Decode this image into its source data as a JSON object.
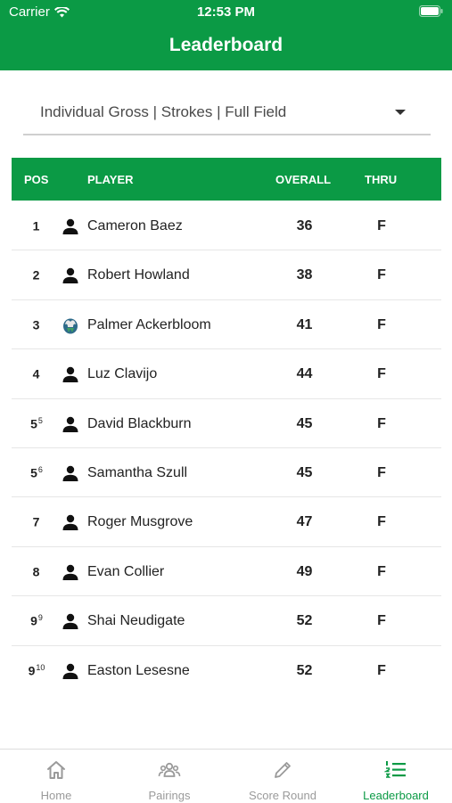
{
  "status_bar": {
    "carrier": "Carrier",
    "time": "12:53 PM"
  },
  "header": {
    "title": "Leaderboard"
  },
  "filter": {
    "selected": "Individual Gross | Strokes | Full Field"
  },
  "table": {
    "columns": {
      "pos": "POS",
      "player": "PLAYER",
      "overall": "OVERALL",
      "thru": "THRU"
    },
    "rows": [
      {
        "pos": "1",
        "tiebreak": "",
        "player": "Cameron Baez",
        "overall": "36",
        "thru": "F",
        "icon": "person-icon"
      },
      {
        "pos": "2",
        "tiebreak": "",
        "player": "Robert Howland",
        "overall": "38",
        "thru": "F",
        "icon": "person-icon"
      },
      {
        "pos": "3",
        "tiebreak": "",
        "player": "Palmer Ackerbloom",
        "overall": "41",
        "thru": "F",
        "icon": "team-logo-icon"
      },
      {
        "pos": "4",
        "tiebreak": "",
        "player": "Luz Clavijo",
        "overall": "44",
        "thru": "F",
        "icon": "person-icon"
      },
      {
        "pos": "5",
        "tiebreak": "5",
        "player": "David Blackburn",
        "overall": "45",
        "thru": "F",
        "icon": "person-icon"
      },
      {
        "pos": "5",
        "tiebreak": "6",
        "player": "Samantha Szull",
        "overall": "45",
        "thru": "F",
        "icon": "person-icon"
      },
      {
        "pos": "7",
        "tiebreak": "",
        "player": "Roger Musgrove",
        "overall": "47",
        "thru": "F",
        "icon": "person-icon"
      },
      {
        "pos": "8",
        "tiebreak": "",
        "player": "Evan Collier",
        "overall": "49",
        "thru": "F",
        "icon": "person-icon"
      },
      {
        "pos": "9",
        "tiebreak": "9",
        "player": "Shai Neudigate",
        "overall": "52",
        "thru": "F",
        "icon": "person-icon"
      },
      {
        "pos": "9",
        "tiebreak": "10",
        "player": "Easton Lesesne",
        "overall": "52",
        "thru": "F",
        "icon": "person-icon"
      }
    ]
  },
  "tabbar": {
    "home": "Home",
    "pairings": "Pairings",
    "score_round": "Score Round",
    "leaderboard": "Leaderboard"
  },
  "colors": {
    "brand": "#0b9a45",
    "inactive_tab": "#9a9a9a"
  }
}
